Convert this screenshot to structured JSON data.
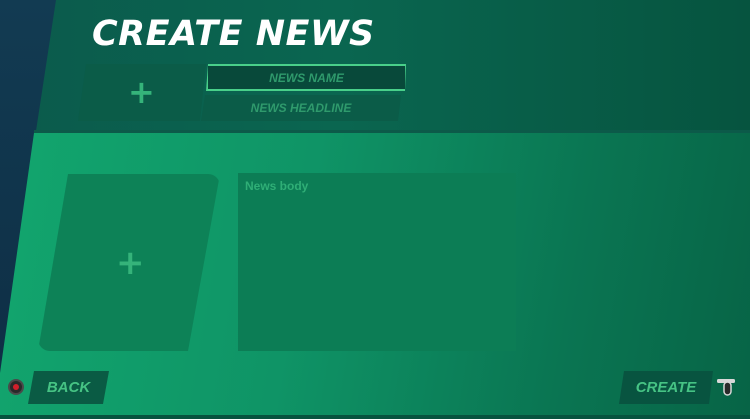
{
  "screen": {
    "title": "CREATE NEWS"
  },
  "thumbnail": {
    "icon": "plus-icon",
    "glyph": "+"
  },
  "fields": {
    "news_name_placeholder": "NEWS NAME",
    "news_headline_placeholder": "NEWS HEADLINE",
    "news_body_placeholder": "News body"
  },
  "image": {
    "icon": "plus-icon",
    "glyph": "+"
  },
  "footer": {
    "back_label": "BACK",
    "back_glyph": "b-button-icon",
    "create_label": "CREATE",
    "create_glyph": "trigger-button-icon"
  },
  "colors": {
    "accent": "#49d08a",
    "panel_top": "#0a6650",
    "panel_main": "#12a66e",
    "text_muted": "#2f9a6c"
  }
}
